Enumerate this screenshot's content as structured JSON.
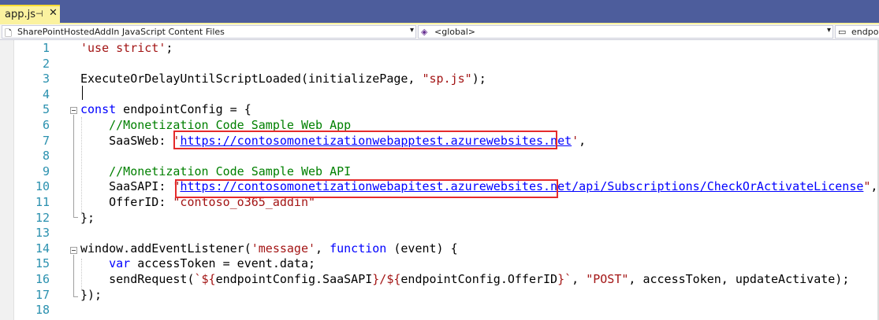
{
  "tab": {
    "name": "app.js",
    "pin_icon": "pin-icon",
    "close_icon": "close-icon"
  },
  "navbar": {
    "project": "SharePointHostedAddIn JavaScript Content Files",
    "scope": "<global>",
    "member": "endpo"
  },
  "lines": [
    {
      "n": "1",
      "segs": [
        {
          "t": "'use strict'",
          "c": "str"
        },
        {
          "t": ";",
          "c": ""
        }
      ]
    },
    {
      "n": "2",
      "segs": []
    },
    {
      "n": "3",
      "segs": [
        {
          "t": "ExecuteOrDelayUntilScriptLoaded(initializePage, ",
          "c": ""
        },
        {
          "t": "\"sp.js\"",
          "c": "str"
        },
        {
          "t": ");",
          "c": ""
        }
      ]
    },
    {
      "n": "4",
      "segs": []
    },
    {
      "n": "5",
      "segs": [
        {
          "t": "const",
          "c": "kw"
        },
        {
          "t": " endpointConfig = {",
          "c": ""
        }
      ]
    },
    {
      "n": "6",
      "segs": [
        {
          "t": "    //Monetization Code Sample Web App",
          "c": "cmt"
        }
      ]
    },
    {
      "n": "7",
      "segs": [
        {
          "t": "    SaaSWeb: ",
          "c": ""
        },
        {
          "t": "'",
          "c": "str"
        },
        {
          "t": "https://contosomonetizationwebapptest.azurewebsites.net",
          "c": "url"
        },
        {
          "t": "'",
          "c": "str"
        },
        {
          "t": ",",
          "c": ""
        }
      ]
    },
    {
      "n": "8",
      "segs": []
    },
    {
      "n": "9",
      "segs": [
        {
          "t": "    //Monetization Code Sample Web API",
          "c": "cmt"
        }
      ]
    },
    {
      "n": "10",
      "segs": [
        {
          "t": "    SaaSAPI: ",
          "c": ""
        },
        {
          "t": "\"",
          "c": "str"
        },
        {
          "t": "https://contosomonetizationwebapitest.azurewebsites.net/api/Subscriptions/CheckOrActivateLicense",
          "c": "url"
        },
        {
          "t": "\"",
          "c": "str"
        },
        {
          "t": ",",
          "c": ""
        }
      ]
    },
    {
      "n": "11",
      "segs": [
        {
          "t": "    OfferID: ",
          "c": ""
        },
        {
          "t": "\"contoso_o365_addin\"",
          "c": "str"
        }
      ]
    },
    {
      "n": "12",
      "segs": [
        {
          "t": "};",
          "c": ""
        }
      ]
    },
    {
      "n": "13",
      "segs": []
    },
    {
      "n": "14",
      "segs": [
        {
          "t": "window.addEventListener(",
          "c": ""
        },
        {
          "t": "'message'",
          "c": "str"
        },
        {
          "t": ", ",
          "c": ""
        },
        {
          "t": "function",
          "c": "kw"
        },
        {
          "t": " (event) {",
          "c": ""
        }
      ]
    },
    {
      "n": "15",
      "segs": [
        {
          "t": "    ",
          "c": ""
        },
        {
          "t": "var",
          "c": "kw"
        },
        {
          "t": " accessToken = event.data;",
          "c": ""
        }
      ]
    },
    {
      "n": "16",
      "segs": [
        {
          "t": "    sendRequest(",
          "c": ""
        },
        {
          "t": "`${",
          "c": "str"
        },
        {
          "t": "endpointConfig.SaaSAPI",
          "c": ""
        },
        {
          "t": "}/${",
          "c": "str"
        },
        {
          "t": "endpointConfig.OfferID",
          "c": ""
        },
        {
          "t": "}`",
          "c": "str"
        },
        {
          "t": ", ",
          "c": ""
        },
        {
          "t": "\"POST\"",
          "c": "str"
        },
        {
          "t": ", accessToken, updateActivate);",
          "c": ""
        }
      ]
    },
    {
      "n": "17",
      "segs": [
        {
          "t": "});",
          "c": ""
        }
      ]
    },
    {
      "n": "18",
      "segs": []
    }
  ],
  "colors": {
    "accent": "#e52b2b",
    "keyword": "#0000ff",
    "string": "#a31515",
    "comment": "#008000",
    "line_number": "#2b91af"
  }
}
